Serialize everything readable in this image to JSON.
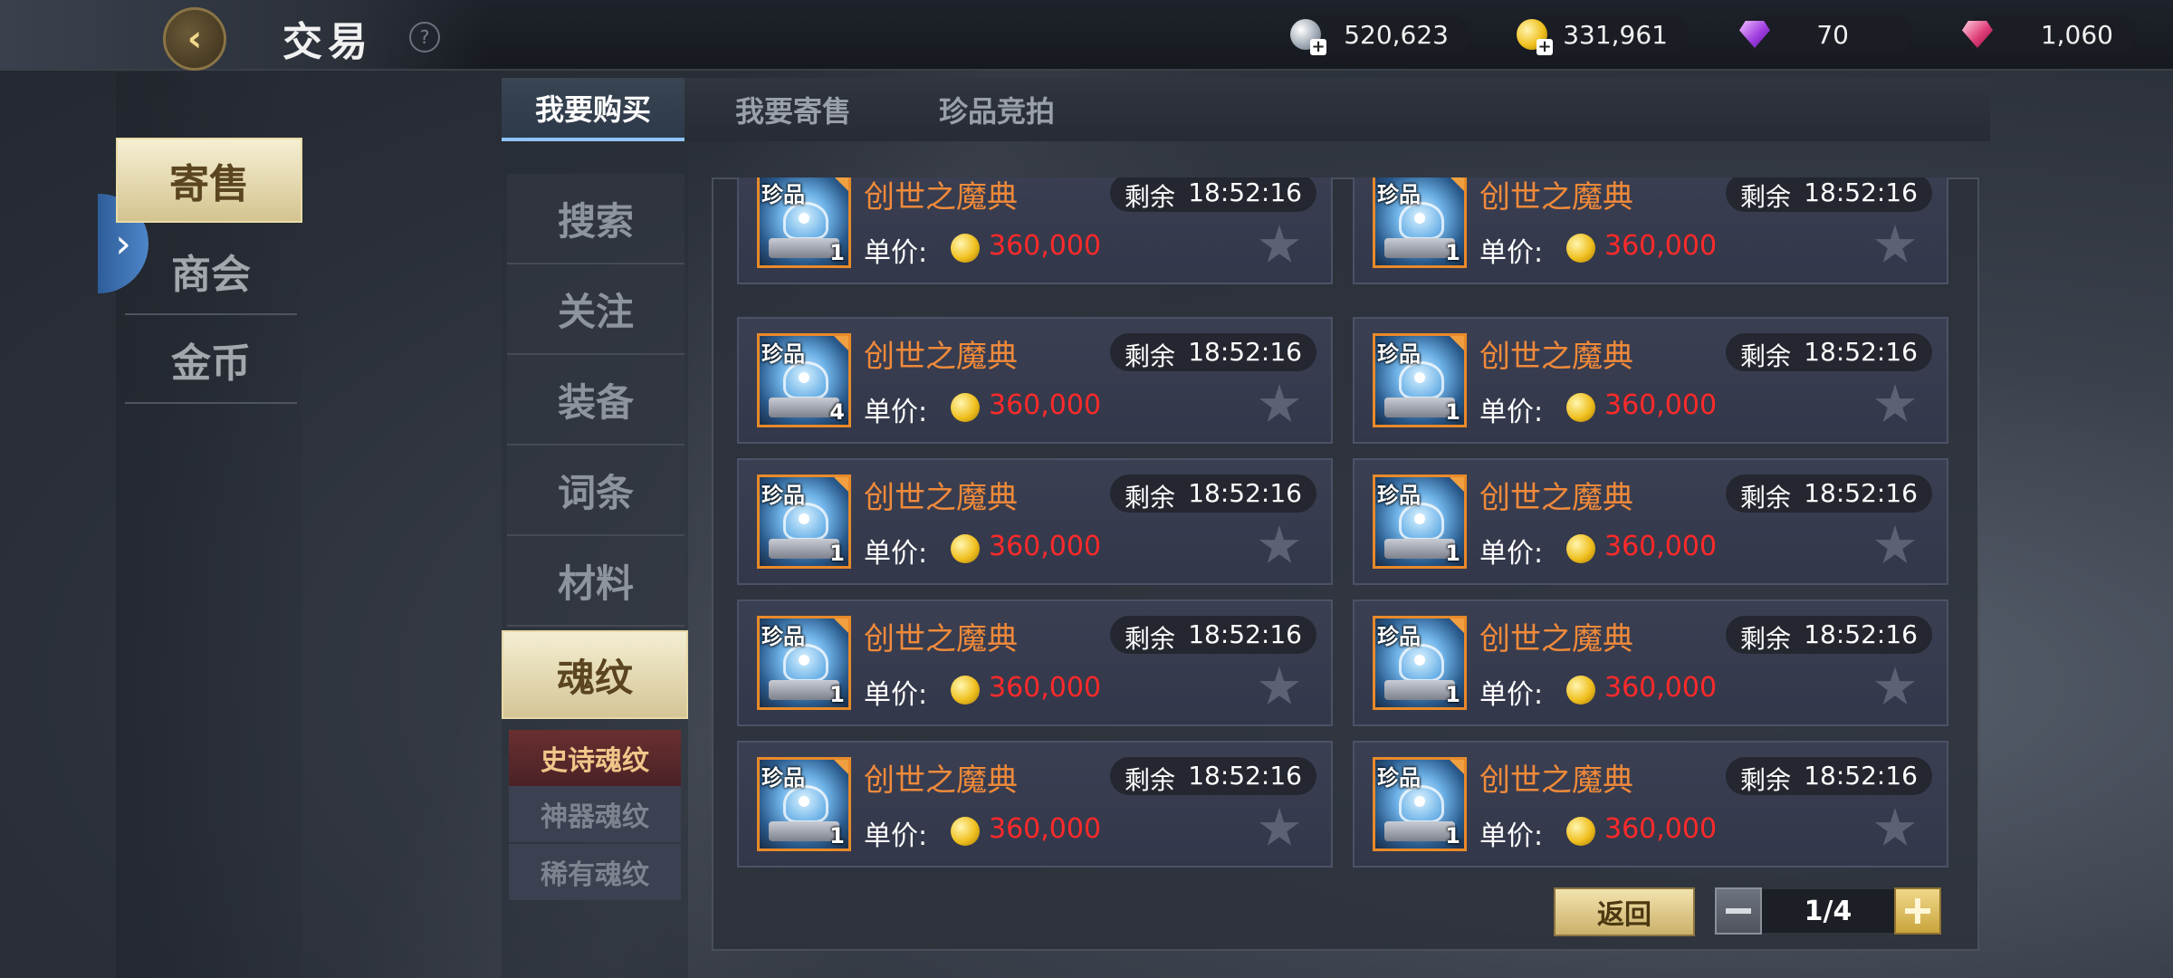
{
  "header": {
    "title": "交易",
    "help": "?",
    "currencies": [
      {
        "icon": "silver-coin-icon",
        "value": "520,623"
      },
      {
        "icon": "gold-coin-icon",
        "value": "331,961"
      },
      {
        "icon": "purple-gem-icon",
        "value": "70"
      },
      {
        "icon": "red-gem-icon",
        "value": "1,060"
      }
    ]
  },
  "left_nav": {
    "items": [
      {
        "label": "寄售",
        "active": true
      },
      {
        "label": "商会",
        "active": false
      },
      {
        "label": "金币",
        "active": false
      }
    ]
  },
  "tabs": [
    {
      "label": "我要购买",
      "active": true
    },
    {
      "label": "我要寄售",
      "active": false
    },
    {
      "label": "珍品竞拍",
      "active": false
    }
  ],
  "categories": [
    {
      "label": "搜索"
    },
    {
      "label": "关注"
    },
    {
      "label": "装备"
    },
    {
      "label": "词条"
    },
    {
      "label": "材料"
    },
    {
      "label": "魂纹",
      "active": true
    }
  ],
  "subcategories": [
    {
      "label": "史诗魂纹",
      "active": true
    },
    {
      "label": "神器魂纹"
    },
    {
      "label": "稀有魂纹"
    }
  ],
  "listings": [
    {
      "badge": "珍品",
      "qty": "1",
      "name": "创世之魔典",
      "remaining_label": "剩余",
      "time": "18:52:16",
      "price_label": "单价:",
      "price": "360,000"
    },
    {
      "badge": "珍品",
      "qty": "1",
      "name": "创世之魔典",
      "remaining_label": "剩余",
      "time": "18:52:16",
      "price_label": "单价:",
      "price": "360,000"
    },
    {
      "badge": "珍品",
      "qty": "4",
      "name": "创世之魔典",
      "remaining_label": "剩余",
      "time": "18:52:16",
      "price_label": "单价:",
      "price": "360,000"
    },
    {
      "badge": "珍品",
      "qty": "1",
      "name": "创世之魔典",
      "remaining_label": "剩余",
      "time": "18:52:16",
      "price_label": "单价:",
      "price": "360,000"
    },
    {
      "badge": "珍品",
      "qty": "1",
      "name": "创世之魔典",
      "remaining_label": "剩余",
      "time": "18:52:16",
      "price_label": "单价:",
      "price": "360,000"
    },
    {
      "badge": "珍品",
      "qty": "1",
      "name": "创世之魔典",
      "remaining_label": "剩余",
      "time": "18:52:16",
      "price_label": "单价:",
      "price": "360,000"
    },
    {
      "badge": "珍品",
      "qty": "1",
      "name": "创世之魔典",
      "remaining_label": "剩余",
      "time": "18:52:16",
      "price_label": "单价:",
      "price": "360,000"
    },
    {
      "badge": "珍品",
      "qty": "1",
      "name": "创世之魔典",
      "remaining_label": "剩余",
      "time": "18:52:16",
      "price_label": "单价:",
      "price": "360,000"
    },
    {
      "badge": "珍品",
      "qty": "1",
      "name": "创世之魔典",
      "remaining_label": "剩余",
      "time": "18:52:16",
      "price_label": "单价:",
      "price": "360,000"
    },
    {
      "badge": "珍品",
      "qty": "1",
      "name": "创世之魔典",
      "remaining_label": "剩余",
      "time": "18:52:16",
      "price_label": "单价:",
      "price": "360,000"
    }
  ],
  "footer": {
    "return_label": "返回",
    "page": "1/4"
  },
  "colors": {
    "item_name": "#f08a3a",
    "price": "#ff2a2a",
    "active_tab_gold": "#d4c490"
  }
}
